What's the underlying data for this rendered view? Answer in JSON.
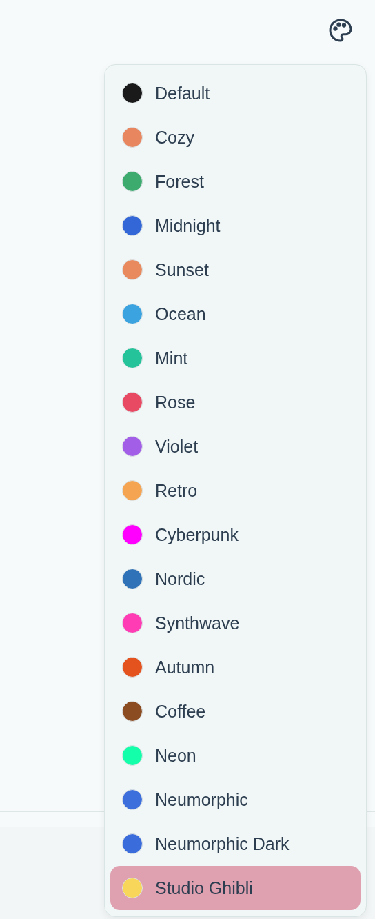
{
  "themes": [
    {
      "label": "Default",
      "color": "#1a1a1a",
      "selected": false
    },
    {
      "label": "Cozy",
      "color": "#e8875f",
      "selected": false
    },
    {
      "label": "Forest",
      "color": "#3daa6e",
      "selected": false
    },
    {
      "label": "Midnight",
      "color": "#3366d6",
      "selected": false
    },
    {
      "label": "Sunset",
      "color": "#e98a5e",
      "selected": false
    },
    {
      "label": "Ocean",
      "color": "#3ba3e0",
      "selected": false
    },
    {
      "label": "Mint",
      "color": "#24c39a",
      "selected": false
    },
    {
      "label": "Rose",
      "color": "#e84a64",
      "selected": false
    },
    {
      "label": "Violet",
      "color": "#a35ee8",
      "selected": false
    },
    {
      "label": "Retro",
      "color": "#f5a552",
      "selected": false
    },
    {
      "label": "Cyberpunk",
      "color": "#ff00ff",
      "selected": false
    },
    {
      "label": "Nordic",
      "color": "#2f72b8",
      "selected": false
    },
    {
      "label": "Synthwave",
      "color": "#ff3cb4",
      "selected": false
    },
    {
      "label": "Autumn",
      "color": "#e4521e",
      "selected": false
    },
    {
      "label": "Coffee",
      "color": "#8b4c22",
      "selected": false
    },
    {
      "label": "Neon",
      "color": "#14ffaa",
      "selected": false
    },
    {
      "label": "Neumorphic",
      "color": "#3d6fdc",
      "selected": false
    },
    {
      "label": "Neumorphic Dark",
      "color": "#3b6cdc",
      "selected": false
    },
    {
      "label": "Studio Ghibli",
      "color": "#f8d65a",
      "selected": true
    }
  ]
}
